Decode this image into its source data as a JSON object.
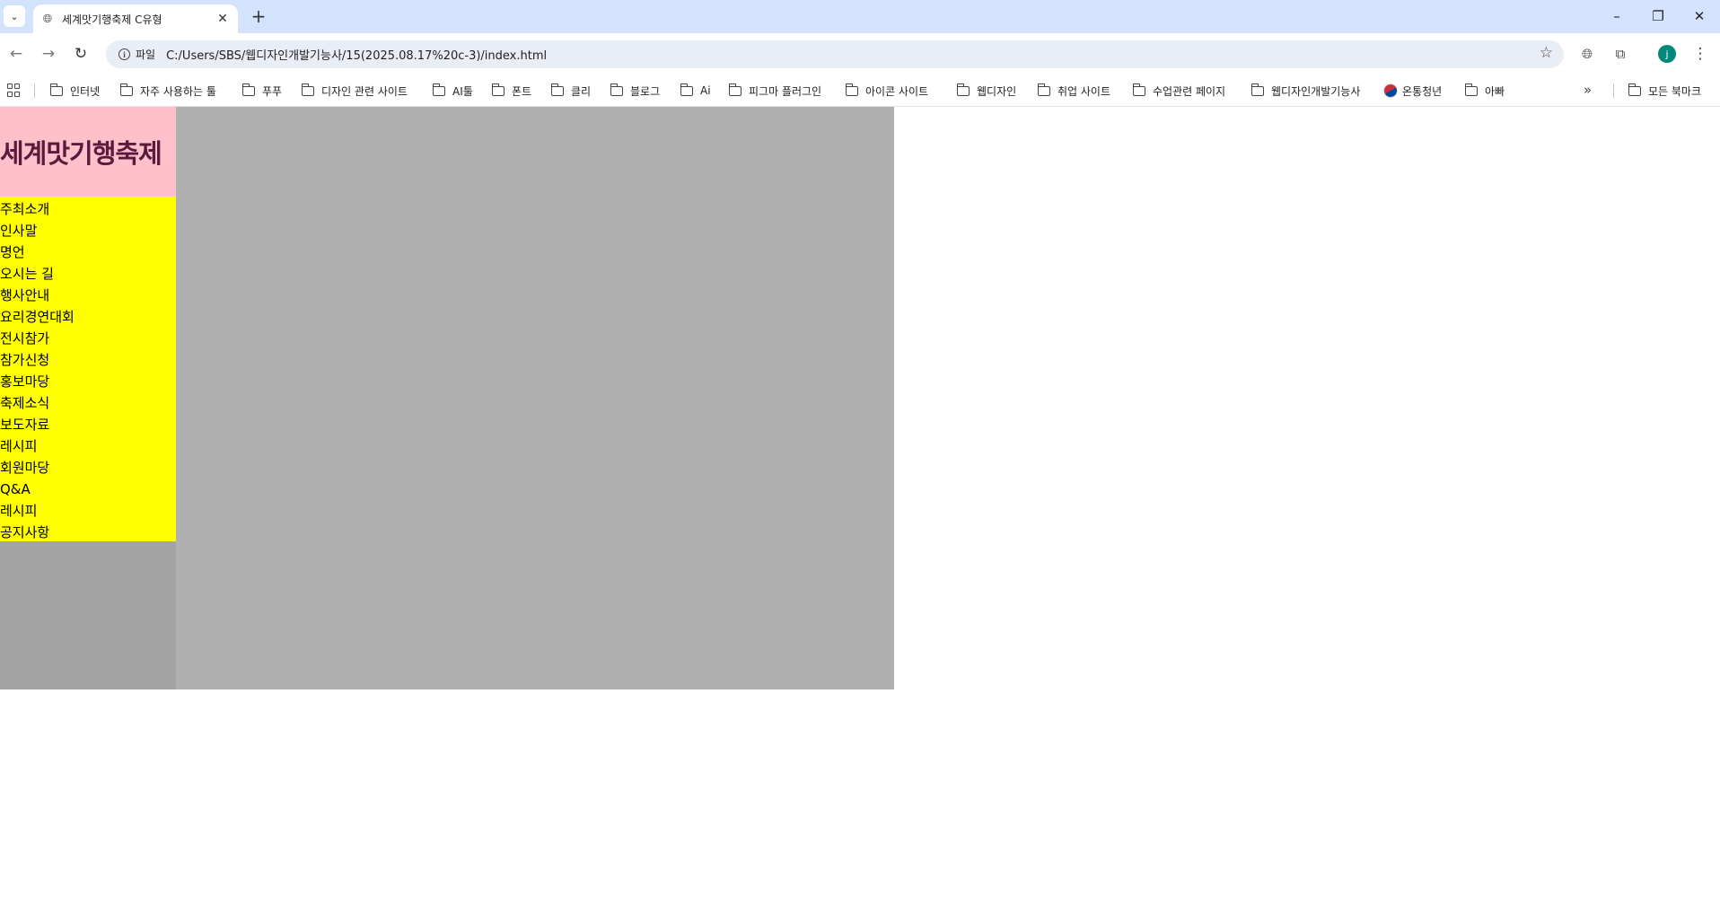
{
  "browser": {
    "tab": {
      "title": "세계맛기행축제 C유형"
    },
    "window_controls": {
      "minimize": "–",
      "restore": "❐",
      "close": "✕"
    },
    "omnibox": {
      "scheme_label": "파일",
      "url": "C:/Users/SBS/웹디자인개발기능사/15(2025.08.17%20c-3)/index.html"
    },
    "profile_initial": "j",
    "bookmarks": [
      "인터넷",
      "자주 사용하는 툴",
      "푸푸",
      "디자인 관련 사이트",
      "AI툴",
      "폰트",
      "클리",
      "블로그",
      "Ai",
      "피그마 플러그인",
      "아이콘 사이트",
      "웹디자인",
      "취업 사이트",
      "수업관련 페이지",
      "웹디자인개발기능사",
      "온통청년",
      "아빠"
    ],
    "all_bookmarks": "모든 북마크"
  },
  "page": {
    "site_title": "세계맛기행축제",
    "nav": [
      "주최소개",
      "인사말",
      "명언",
      "오시는 길",
      "행사안내",
      "요리경연대회",
      "전시참가",
      "참가신청",
      "홍보마당",
      "축제소식",
      "보도자료",
      "레시피",
      "회원마당",
      "Q&A",
      "레시피",
      "공지사항"
    ]
  },
  "colors": {
    "header_bg": "#ffc0cb",
    "title_text": "#5a1a3c",
    "nav_bg": "#ffff00",
    "left_column_bg": "#a3a3a3",
    "main_bg": "#b0b0b0",
    "tabstrip_bg": "#d3e3fd"
  }
}
